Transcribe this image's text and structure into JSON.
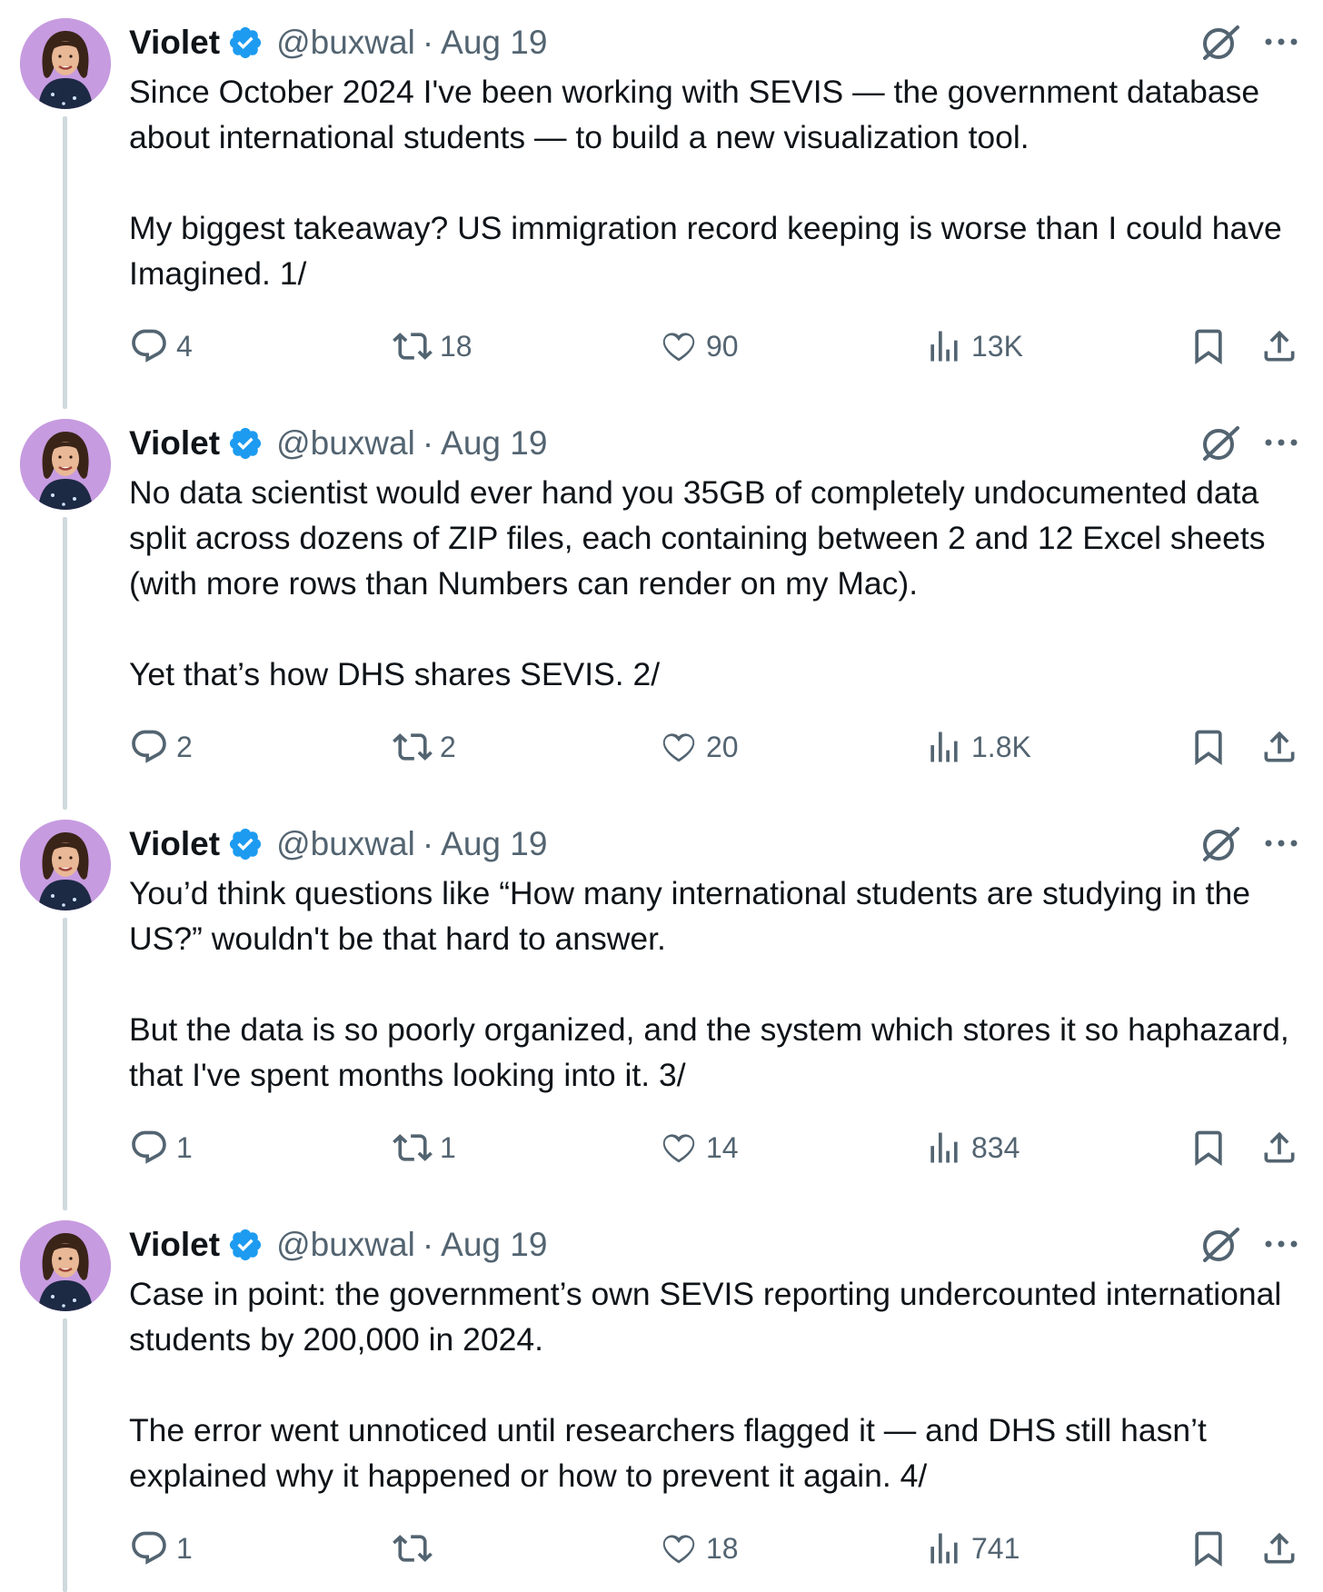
{
  "tweets": [
    {
      "name": "Violet",
      "handle": "@buxwal",
      "separator": "·",
      "date": "Aug 19",
      "paragraphs": [
        "Since October 2024 I've been working with SEVIS — the government database about international students — to build a new visualization tool.",
        "My biggest takeaway? US immigration record keeping is worse than I could have Imagined. 1/"
      ],
      "replies": "4",
      "reposts": "18",
      "likes": "90",
      "views": "13K"
    },
    {
      "name": "Violet",
      "handle": "@buxwal",
      "separator": "·",
      "date": "Aug 19",
      "paragraphs": [
        "No data scientist would ever hand you 35GB of completely undocumented data split across dozens of ZIP files, each containing between 2 and 12 Excel sheets (with more rows than Numbers can render on my Mac).",
        "Yet that’s how DHS shares SEVIS. 2/"
      ],
      "replies": "2",
      "reposts": "2",
      "likes": "20",
      "views": "1.8K"
    },
    {
      "name": "Violet",
      "handle": "@buxwal",
      "separator": "·",
      "date": "Aug 19",
      "paragraphs": [
        "You’d think questions like “How many international students are studying in the US?” wouldn't be that hard to answer.",
        "But the data is so poorly organized, and the system which stores it so haphazard, that I've spent months looking into it. 3/"
      ],
      "replies": "1",
      "reposts": "1",
      "likes": "14",
      "views": "834"
    },
    {
      "name": "Violet",
      "handle": "@buxwal",
      "separator": "·",
      "date": "Aug 19",
      "paragraphs": [
        "Case in point: the government’s own SEVIS reporting undercounted international students by 200,000 in 2024.",
        "The error went unnoticed until researchers flagged it — and DHS still hasn’t explained why it happened or how to prevent it again. 4/"
      ],
      "replies": "1",
      "reposts": "",
      "likes": "18",
      "views": "741"
    }
  ],
  "icons": {
    "verified": "verified-badge-icon",
    "grok": "grok-icon",
    "more": "more-options-icon",
    "reply": "reply-icon",
    "repost": "repost-icon",
    "like": "heart-icon",
    "views": "views-chart-icon",
    "bookmark": "bookmark-icon",
    "share": "share-icon"
  },
  "colors": {
    "verified": "#1d9bf0",
    "text": "#0f1419",
    "secondary": "#536471",
    "thread_line": "#cfd9de",
    "avatar_bg": "#c79be0"
  }
}
